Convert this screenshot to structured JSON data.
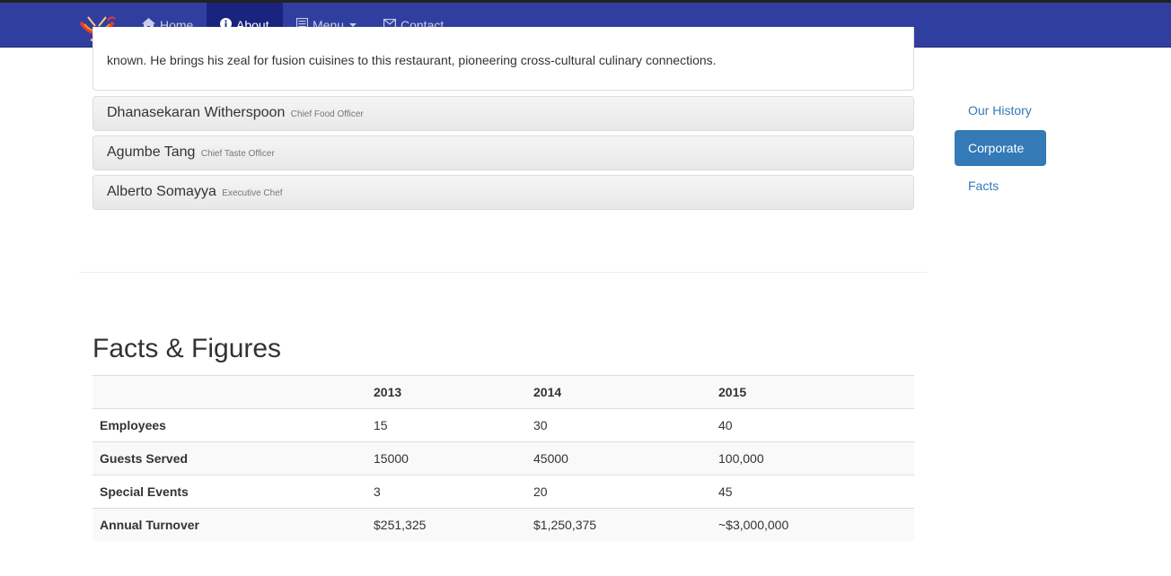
{
  "nav": {
    "items": [
      {
        "label": "Home",
        "icon": "home-icon"
      },
      {
        "label": "About",
        "icon": "info-icon",
        "active": true
      },
      {
        "label": "Menu",
        "icon": "list-icon",
        "dropdown": true
      },
      {
        "label": "Contact",
        "icon": "envelope-icon"
      }
    ]
  },
  "bio": {
    "text": "known. He brings his zeal for fusion cuisines to this restaurant, pioneering cross-cultural culinary connections."
  },
  "leaders": [
    {
      "name": "Dhanasekaran Witherspoon",
      "role": "Chief Food Officer"
    },
    {
      "name": "Agumbe Tang",
      "role": "Chief Taste Officer"
    },
    {
      "name": "Alberto Somayya",
      "role": "Executive Chef"
    }
  ],
  "sidenav": [
    {
      "label": "Our History"
    },
    {
      "label": "Corporate",
      "active": true
    },
    {
      "label": "Facts"
    }
  ],
  "facts": {
    "title": "Facts & Figures",
    "headers": [
      "",
      "2013",
      "2014",
      "2015"
    ],
    "rows": [
      [
        "Employees",
        "15",
        "30",
        "40"
      ],
      [
        "Guests Served",
        "15000",
        "45000",
        "100,000"
      ],
      [
        "Special Events",
        "3",
        "20",
        "45"
      ],
      [
        "Annual Turnover",
        "$251,325",
        "$1,250,375",
        "~$3,000,000"
      ]
    ]
  },
  "colors": {
    "navbar": "#303f9f",
    "navbar_active": "#1a237e",
    "link": "#337ab7"
  }
}
